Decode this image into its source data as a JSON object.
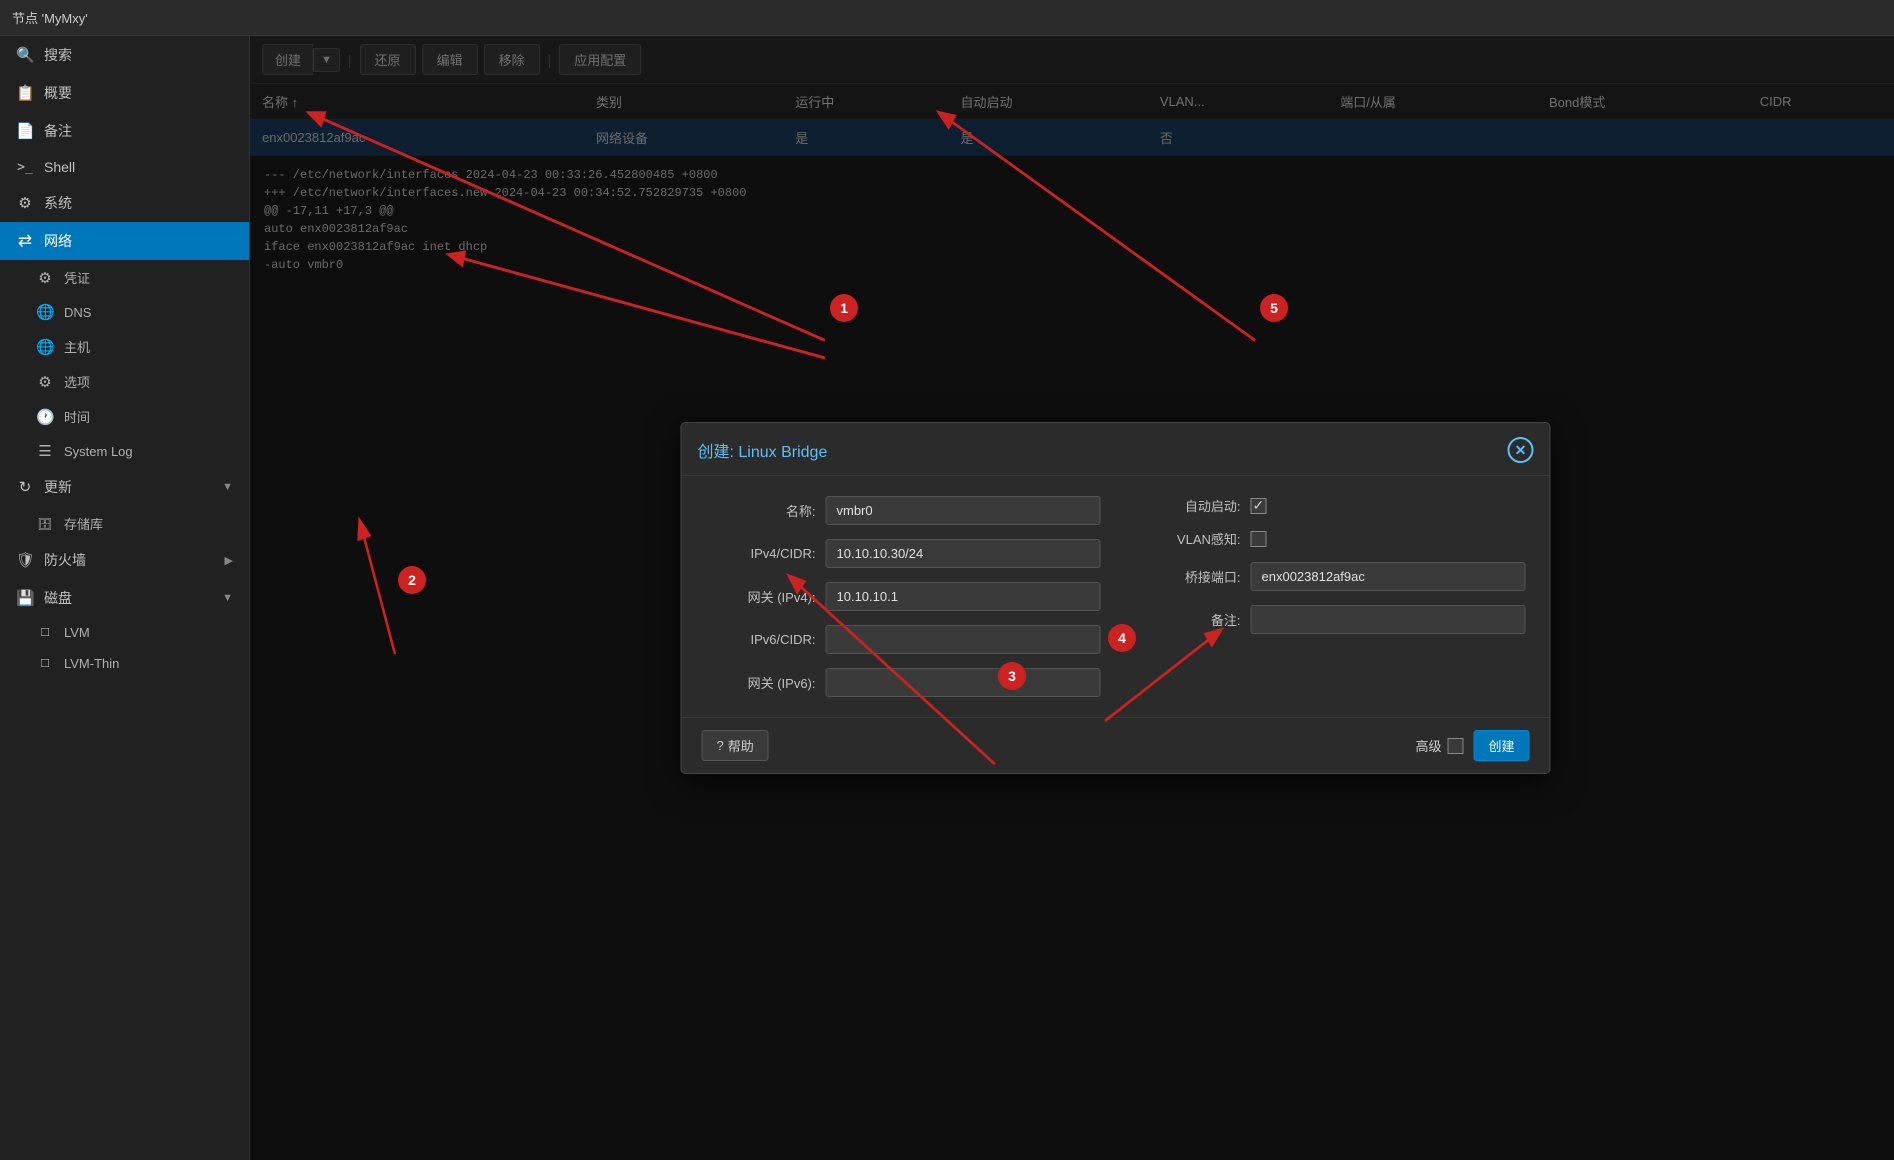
{
  "titleBar": {
    "text": "节点 'MyMxy'"
  },
  "sidebar": {
    "items": [
      {
        "id": "search",
        "icon": "🔍",
        "label": "搜索",
        "active": false,
        "sub": false
      },
      {
        "id": "overview",
        "icon": "📋",
        "label": "概要",
        "active": false,
        "sub": false
      },
      {
        "id": "notes",
        "icon": "📄",
        "label": "备注",
        "active": false,
        "sub": false
      },
      {
        "id": "shell",
        "icon": ">_",
        "label": "Shell",
        "active": false,
        "sub": false
      },
      {
        "id": "system",
        "icon": "⚙",
        "label": "系统",
        "active": false,
        "sub": false
      },
      {
        "id": "network",
        "icon": "⇄",
        "label": "网络",
        "active": true,
        "sub": false
      },
      {
        "id": "credentials",
        "icon": "⚙",
        "label": "凭证",
        "active": false,
        "sub": true
      },
      {
        "id": "dns",
        "icon": "🌐",
        "label": "DNS",
        "active": false,
        "sub": true
      },
      {
        "id": "hosts",
        "icon": "🌐",
        "label": "主机",
        "active": false,
        "sub": true
      },
      {
        "id": "options",
        "icon": "⚙",
        "label": "选项",
        "active": false,
        "sub": true
      },
      {
        "id": "time",
        "icon": "🕐",
        "label": "时间",
        "active": false,
        "sub": true
      },
      {
        "id": "systemlog",
        "icon": "☰",
        "label": "System Log",
        "active": false,
        "sub": true
      },
      {
        "id": "updates",
        "icon": "↻",
        "label": "更新",
        "active": false,
        "sub": false,
        "hasChevron": true
      },
      {
        "id": "storage",
        "icon": "🗄",
        "label": "存储库",
        "active": false,
        "sub": true
      },
      {
        "id": "firewall",
        "icon": "🛡",
        "label": "防火墙",
        "active": false,
        "sub": false,
        "hasChevron": true
      },
      {
        "id": "disk",
        "icon": "💾",
        "label": "磁盘",
        "active": false,
        "sub": false,
        "hasChevron": true
      },
      {
        "id": "lvm",
        "icon": "☐",
        "label": "LVM",
        "active": false,
        "sub": true
      },
      {
        "id": "lvmthin",
        "icon": "☐",
        "label": "LVM-Thin",
        "active": false,
        "sub": true
      }
    ]
  },
  "toolbar": {
    "createLabel": "创建",
    "restoreLabel": "还原",
    "editLabel": "编辑",
    "removeLabel": "移除",
    "applyConfigLabel": "应用配置"
  },
  "table": {
    "columns": [
      "名称 ↑",
      "类别",
      "运行中",
      "自动启动",
      "VLAN...",
      "端口/从属",
      "Bond模式",
      "CIDR"
    ],
    "rows": [
      {
        "name": "enx0023812af9ac",
        "type": "网络设备",
        "running": "是",
        "autostart": "是",
        "vlan": "否",
        "ports": "",
        "bond": "",
        "cidr": ""
      }
    ]
  },
  "dialog": {
    "title": "创建:",
    "titleType": "Linux Bridge",
    "fields": {
      "name": {
        "label": "名称:",
        "value": "vmbr0"
      },
      "ipv4cidr": {
        "label": "IPv4/CIDR:",
        "value": "10.10.10.30/24"
      },
      "gatewayIPv4": {
        "label": "网关 (IPv4):",
        "value": "10.10.10.1"
      },
      "ipv6cidr": {
        "label": "IPv6/CIDR:",
        "value": ""
      },
      "gatewayIPv6": {
        "label": "网关 (IPv6):",
        "value": ""
      },
      "autostart": {
        "label": "自动启动:",
        "checked": true
      },
      "vlanAware": {
        "label": "VLAN感知:",
        "checked": false
      },
      "bridgePorts": {
        "label": "桥接端口:",
        "value": "enx0023812af9ac"
      },
      "comment": {
        "label": "备注:",
        "value": ""
      }
    },
    "footer": {
      "helpLabel": "帮助",
      "advancedLabel": "高级",
      "createLabel": "创建"
    }
  },
  "terminal": {
    "lines": [
      "--- /etc/network/interfaces    2024-04-23 00:33:26.452800485 +0800",
      "+++ /etc/network/interfaces.new 2024-04-23 00:34:52.752829735 +0800",
      "@@ -17,11 +17,3 @@",
      " auto enx0023812af9ac",
      " iface enx0023812af9ac inet dhcp",
      "",
      "-auto vmbr0"
    ]
  },
  "annotations": [
    {
      "id": "1",
      "label": "1"
    },
    {
      "id": "2",
      "label": "2"
    },
    {
      "id": "3",
      "label": "3"
    },
    {
      "id": "4",
      "label": "4"
    },
    {
      "id": "5",
      "label": "5"
    }
  ]
}
